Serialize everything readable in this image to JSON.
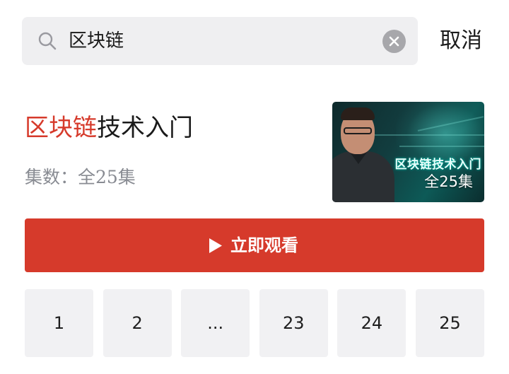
{
  "search": {
    "query": "区块链",
    "cancel_label": "取消"
  },
  "result": {
    "title_highlight": "区块链",
    "title_rest": "技术入门",
    "episodes_label": "集数：全25集",
    "thumbnail": {
      "overlay_title": "区块链技术入门",
      "badge": "全25集"
    },
    "watch_label": "立即观看",
    "episode_buttons": [
      "1",
      "2",
      "...",
      "23",
      "24",
      "25"
    ]
  },
  "colors": {
    "accent": "#d63a2b",
    "search_bg": "#efeff1",
    "cell_bg": "#f1f1f3",
    "muted_text": "#888b92"
  },
  "icons": {
    "search": "search-icon",
    "clear": "clear-icon",
    "play": "play-icon"
  }
}
